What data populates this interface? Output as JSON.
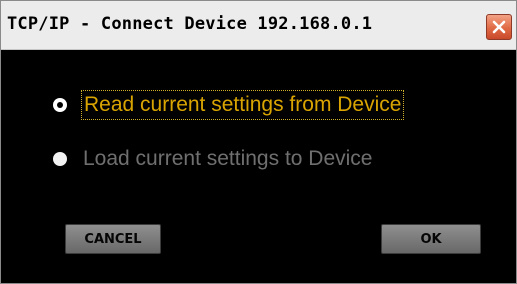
{
  "window": {
    "title": "TCP/IP - Connect Device 192.168.0.1",
    "close_icon": "close-x-icon"
  },
  "options": {
    "read": {
      "label": "Read current settings from Device",
      "selected": true
    },
    "load": {
      "label": "Load current settings to Device",
      "selected": false,
      "disabled": true
    }
  },
  "buttons": {
    "cancel_label": "CANCEL",
    "ok_label": "OK"
  },
  "colors": {
    "background": "#000000",
    "selected_text": "#d9a400",
    "disabled_text": "#6f6f6f",
    "button_face": "#7a7a7a",
    "close_button": "#e06a45"
  }
}
